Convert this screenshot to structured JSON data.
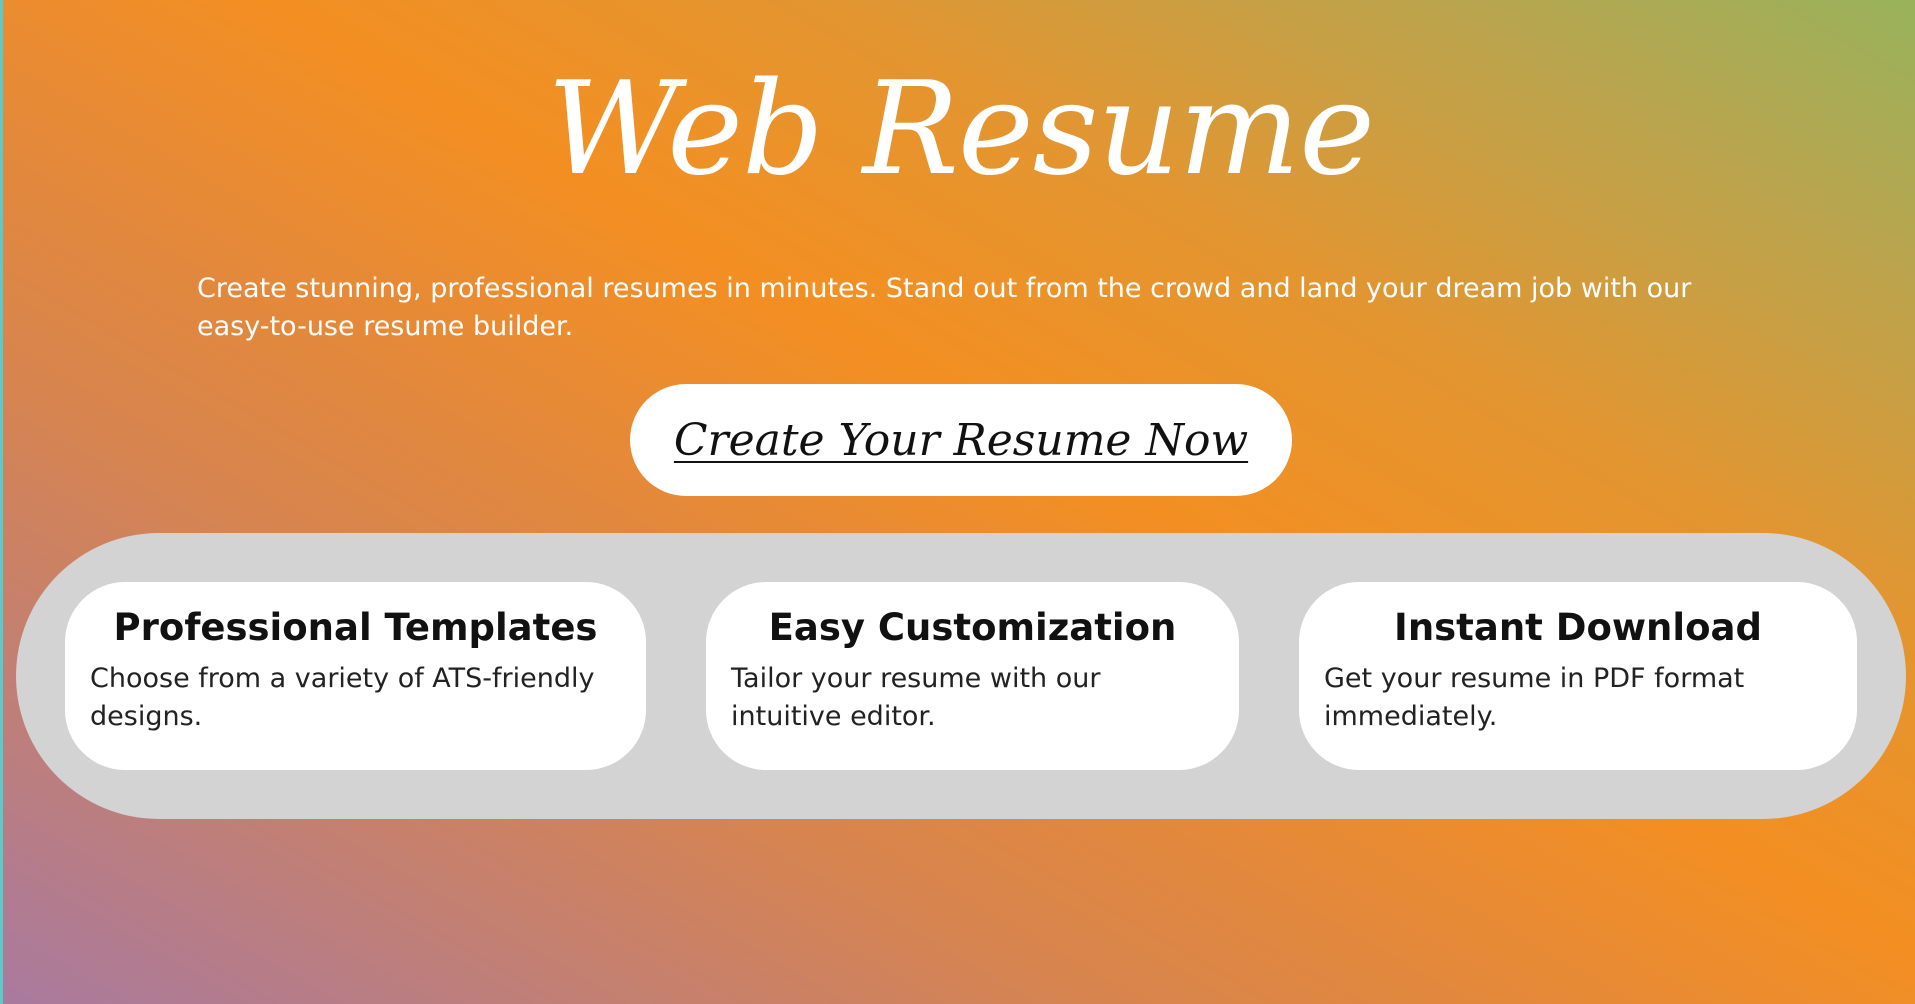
{
  "hero": {
    "title": "Web Resume",
    "subtitle": "Create stunning, professional resumes in minutes. Stand out from the crowd and land your dream job with our easy-to-use resume builder.",
    "cta_label": "Create Your Resume Now"
  },
  "features": [
    {
      "title": "Professional Templates",
      "text": "Choose from a variety of ATS-friendly designs."
    },
    {
      "title": "Easy Customization",
      "text": "Tailor your resume with our intuitive editor."
    },
    {
      "title": "Instant Download",
      "text": "Get your resume in PDF format immediately."
    }
  ],
  "colors": {
    "gradient_orange": "#f38f22",
    "gradient_purple": "#a97a9f",
    "gradient_green": "#98b35b",
    "features_panel": "#d3d3d3",
    "card_background": "#ffffff"
  }
}
